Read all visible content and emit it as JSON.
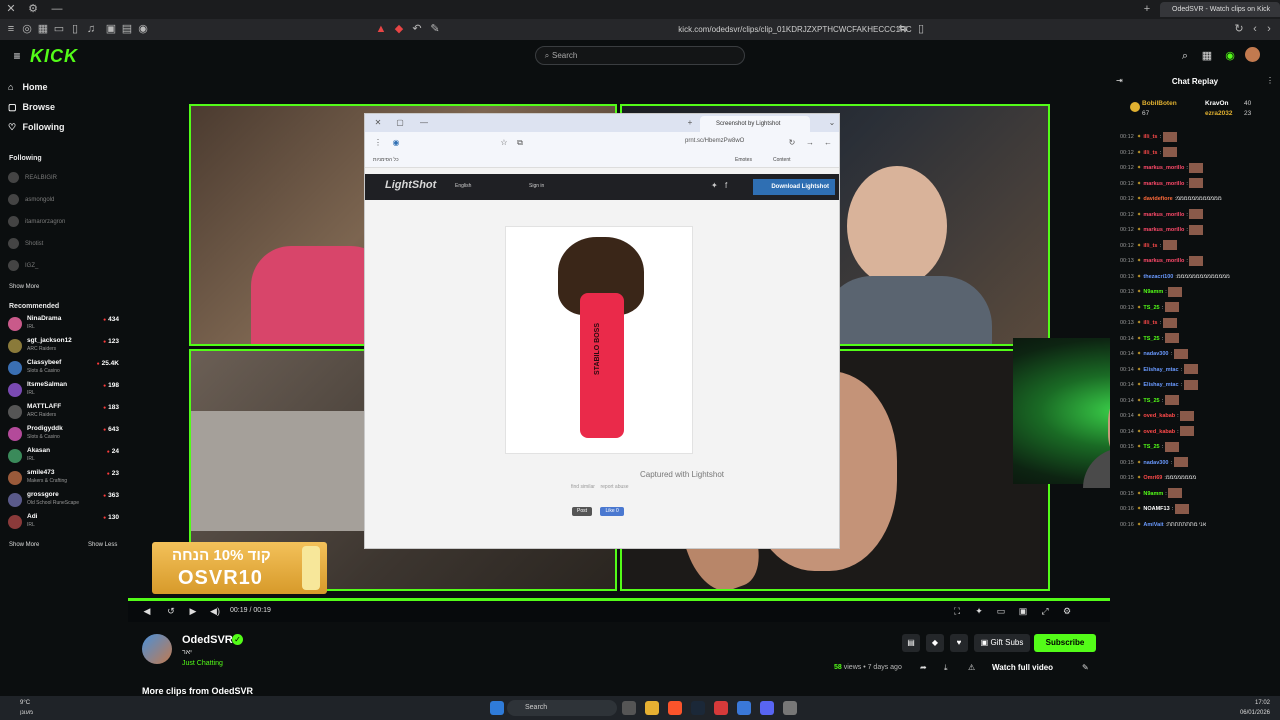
{
  "browser": {
    "url": "kick.com/odedsvr/clips/clip_01KDRJZXPTHCWCFAKHECCC1RC",
    "active_tab_title": "OdedSVR - Watch clips on Kick"
  },
  "header": {
    "logo": "KICK",
    "search_placeholder": "Search"
  },
  "sidebar": {
    "nav": [
      {
        "label": "Home",
        "icon": "home-icon"
      },
      {
        "label": "Browse",
        "icon": "browse-icon"
      },
      {
        "label": "Following",
        "icon": "heart-icon"
      }
    ],
    "following_title": "Following",
    "following": [
      "REALBIGIR",
      "asmongold",
      "itamarorzagron",
      "Shotist",
      "IGZ_"
    ],
    "show_more_1": "Show More",
    "recommended_title": "Recommended",
    "recommended": [
      {
        "name": "NinaDrama",
        "category": "IRL",
        "viewers": "434",
        "color": "#c95a8a"
      },
      {
        "name": "sgt_jackson12",
        "category": "ARC Raiders",
        "viewers": "123",
        "color": "#8a7a3a"
      },
      {
        "name": "Classybeef",
        "category": "Slots & Casino",
        "viewers": "25.4K",
        "color": "#3a6fb3"
      },
      {
        "name": "ItsmeSalman",
        "category": "IRL",
        "viewers": "198",
        "color": "#7a4ab3"
      },
      {
        "name": "MATTLAFF",
        "category": "ARC Raiders",
        "viewers": "183",
        "color": "#555555"
      },
      {
        "name": "Prodigyddk",
        "category": "Slots & Casino",
        "viewers": "643",
        "color": "#b34a9a"
      },
      {
        "name": "Akasan",
        "category": "IRL",
        "viewers": "24",
        "color": "#3a8a5a"
      },
      {
        "name": "smile473",
        "category": "Makers & Crafting",
        "viewers": "23",
        "color": "#9a5a3a"
      },
      {
        "name": "grossgore",
        "category": "Old School RuneScape",
        "viewers": "363",
        "color": "#5a5a8a"
      },
      {
        "name": "Adi",
        "category": "IRL",
        "viewers": "130",
        "color": "#8a3a3a"
      }
    ],
    "show_more_2": "Show More",
    "show_less": "Show Less"
  },
  "video": {
    "lightshot": {
      "tab_title": "Screenshot by Lightshot",
      "url": "prnt.sc/HbemzPw8wO",
      "logo": "LightShot",
      "language": "English",
      "signin": "Sign in",
      "download": "Download Lightshot",
      "bookmark_1": "כל הסימניות",
      "emotes": "Emotes",
      "content": "Content",
      "caption": "Captured with Lightshot",
      "find_similar": "find similar",
      "report_abuse": "report abuse",
      "post": "Post",
      "like": "Like 0",
      "marker_text": "STABILO BOSS"
    },
    "promo_line1": "קוד 10% הנחה",
    "promo_line2": "OSVR10",
    "timecode": "00:19 / 00:19",
    "progress": 1.0
  },
  "info": {
    "channel": "OdedSVR",
    "clip_title": "יאר",
    "category": "Just Chatting",
    "gift_subs": "Gift Subs",
    "subscribe": "Subscribe",
    "views_count": "58",
    "views_suffix": "views • 7 days ago",
    "watch_full": "Watch full video",
    "more_clips": "More clips from OdedSVR"
  },
  "chat": {
    "title": "Chat Replay",
    "pinned": [
      {
        "user": "BobilBoten",
        "value": "67"
      },
      {
        "user": "KravOn",
        "value": "40"
      },
      {
        "user": "ezra2032",
        "value": "23"
      }
    ],
    "messages": [
      {
        "time": "00:12",
        "user": "illi_ts",
        "color": "#ff4a4a",
        "text": ""
      },
      {
        "time": "00:12",
        "user": "illi_ts",
        "color": "#ff4a4a",
        "text": ""
      },
      {
        "time": "00:12",
        "user": "markus_morillo",
        "color": "#ff4a6a",
        "text": ""
      },
      {
        "time": "00:12",
        "user": "markus_morillo",
        "color": "#ff4a6a",
        "text": ""
      },
      {
        "time": "00:12",
        "user": "davidefiore",
        "color": "#ff6a3a",
        "text": "ממממממממממממ"
      },
      {
        "time": "00:12",
        "user": "markus_morillo",
        "color": "#ff4a6a",
        "text": ""
      },
      {
        "time": "00:12",
        "user": "markus_morillo",
        "color": "#ff4a6a",
        "text": ""
      },
      {
        "time": "00:12",
        "user": "illi_ts",
        "color": "#ff4a4a",
        "text": ""
      },
      {
        "time": "00:13",
        "user": "markus_morillo",
        "color": "#ff4a6a",
        "text": ""
      },
      {
        "time": "00:13",
        "user": "thezacri100",
        "color": "#6a9aff",
        "text": "ממממממממממממממ"
      },
      {
        "time": "00:13",
        "user": "N9amm",
        "color": "#53fc18",
        "text": ""
      },
      {
        "time": "00:13",
        "user": "TS_25",
        "color": "#53fc18",
        "text": ""
      },
      {
        "time": "00:13",
        "user": "illi_ts",
        "color": "#ff4a4a",
        "text": ""
      },
      {
        "time": "00:14",
        "user": "TS_25",
        "color": "#53fc18",
        "text": ""
      },
      {
        "time": "00:14",
        "user": "nadav300",
        "color": "#6a9aff",
        "text": ""
      },
      {
        "time": "00:14",
        "user": "Elishay_mtac",
        "color": "#6a9aff",
        "text": ""
      },
      {
        "time": "00:14",
        "user": "Elishay_mtac",
        "color": "#6a9aff",
        "text": ""
      },
      {
        "time": "00:14",
        "user": "TS_25",
        "color": "#53fc18",
        "text": ""
      },
      {
        "time": "00:14",
        "user": "oved_kabab",
        "color": "#ff4a4a",
        "text": ""
      },
      {
        "time": "00:14",
        "user": "oved_kabab",
        "color": "#ff4a4a",
        "text": ""
      },
      {
        "time": "00:15",
        "user": "TS_25",
        "color": "#53fc18",
        "text": ""
      },
      {
        "time": "00:15",
        "user": "nadav300",
        "color": "#6a9aff",
        "text": ""
      },
      {
        "time": "00:15",
        "user": "Omri69",
        "color": "#ff4a4a",
        "text": "ממממממממ"
      },
      {
        "time": "00:15",
        "user": "N9amm",
        "color": "#53fc18",
        "text": ""
      },
      {
        "time": "00:16",
        "user": "NOAMF13",
        "color": "#ffffff",
        "text": ""
      },
      {
        "time": "00:16",
        "user": "AmiVait",
        "color": "#6a9aff",
        "text": "אני מתתתתתתת"
      }
    ]
  },
  "taskbar": {
    "search": "Search",
    "weather_temp": "9°C",
    "weather_desc": "מעונן",
    "time": "17:02",
    "date": "06/01/2026"
  },
  "colors": {
    "accent": "#53fc18",
    "background": "#0b0e0f"
  }
}
